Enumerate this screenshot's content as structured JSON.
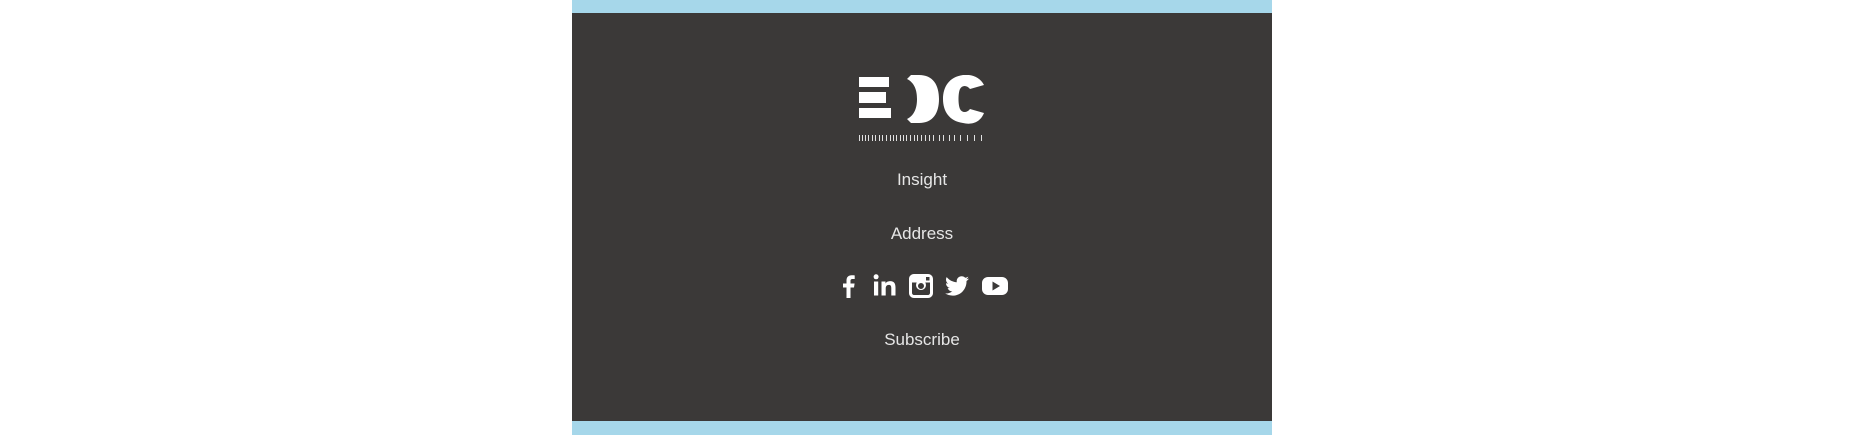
{
  "colors": {
    "page_background": "#ffffff",
    "accent_bar": "#a6d7ea",
    "footer_background": "#3b3938",
    "footer_text": "#e6e6e6",
    "icon": "#ffffff"
  },
  "logo": {
    "mark": "EDC",
    "icon": "edc-logo"
  },
  "footer": {
    "insight_label": "Insight",
    "address_label": "Address",
    "subscribe_label": "Subscribe"
  },
  "social": [
    {
      "icon": "facebook-icon"
    },
    {
      "icon": "linkedin-icon"
    },
    {
      "icon": "instagram-icon"
    },
    {
      "icon": "twitter-icon"
    },
    {
      "icon": "youtube-icon"
    }
  ]
}
